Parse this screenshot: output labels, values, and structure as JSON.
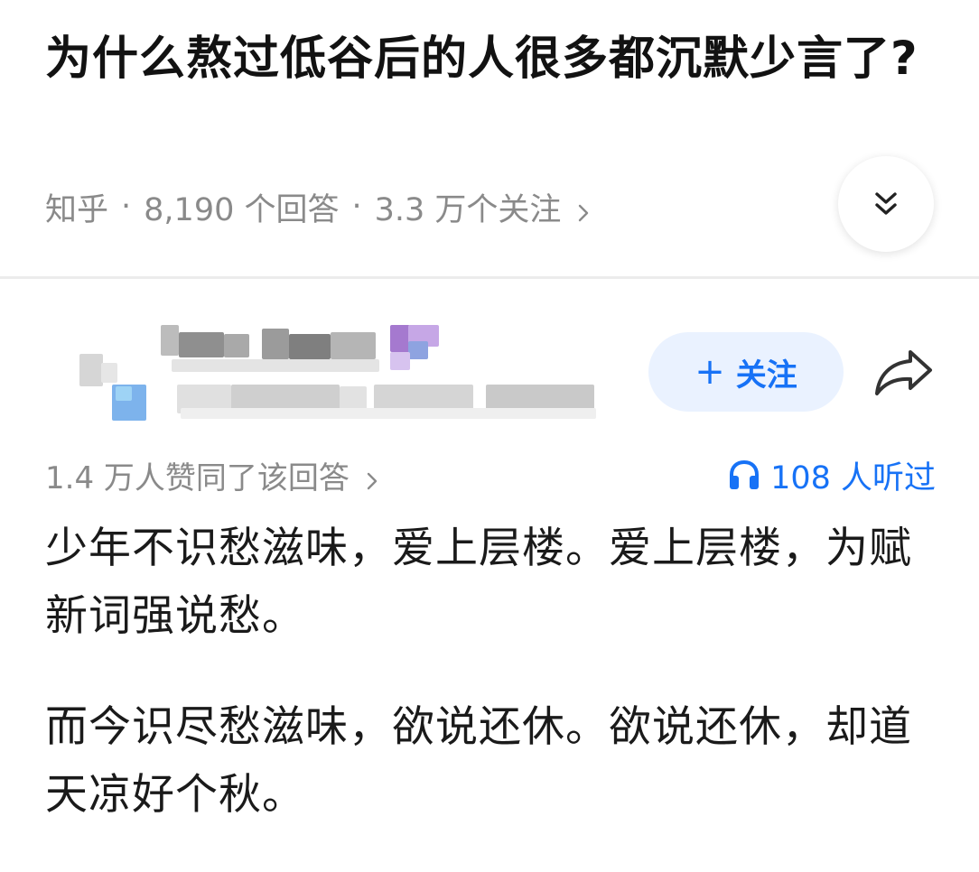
{
  "question": {
    "title": "为什么熬过低谷后的人很多都沉默少言了?",
    "source": "知乎",
    "separator": "·",
    "answer_count": "8,190 个回答",
    "follower_count": "3.3 万个关注"
  },
  "expand": {
    "icon": "double-chevron-down-icon"
  },
  "author": {
    "follow_plus": "+",
    "follow_label": "关注",
    "share_icon": "share-arrow-icon"
  },
  "stats": {
    "upvote_text": "1.4 万人赞同了该回答",
    "listen_text": "108 人听过"
  },
  "answer": {
    "paragraphs": [
      "少年不识愁滋味，爱上层楼。爱上层楼，为赋新词强说愁。",
      "而今识尽愁滋味，欲说还休。欲说还休，却道天凉好个秋。"
    ]
  },
  "colors": {
    "accent": "#1772f6",
    "follow_bg": "#eaf2ff",
    "meta_text": "#8a8a8a",
    "title_text": "#121212"
  }
}
